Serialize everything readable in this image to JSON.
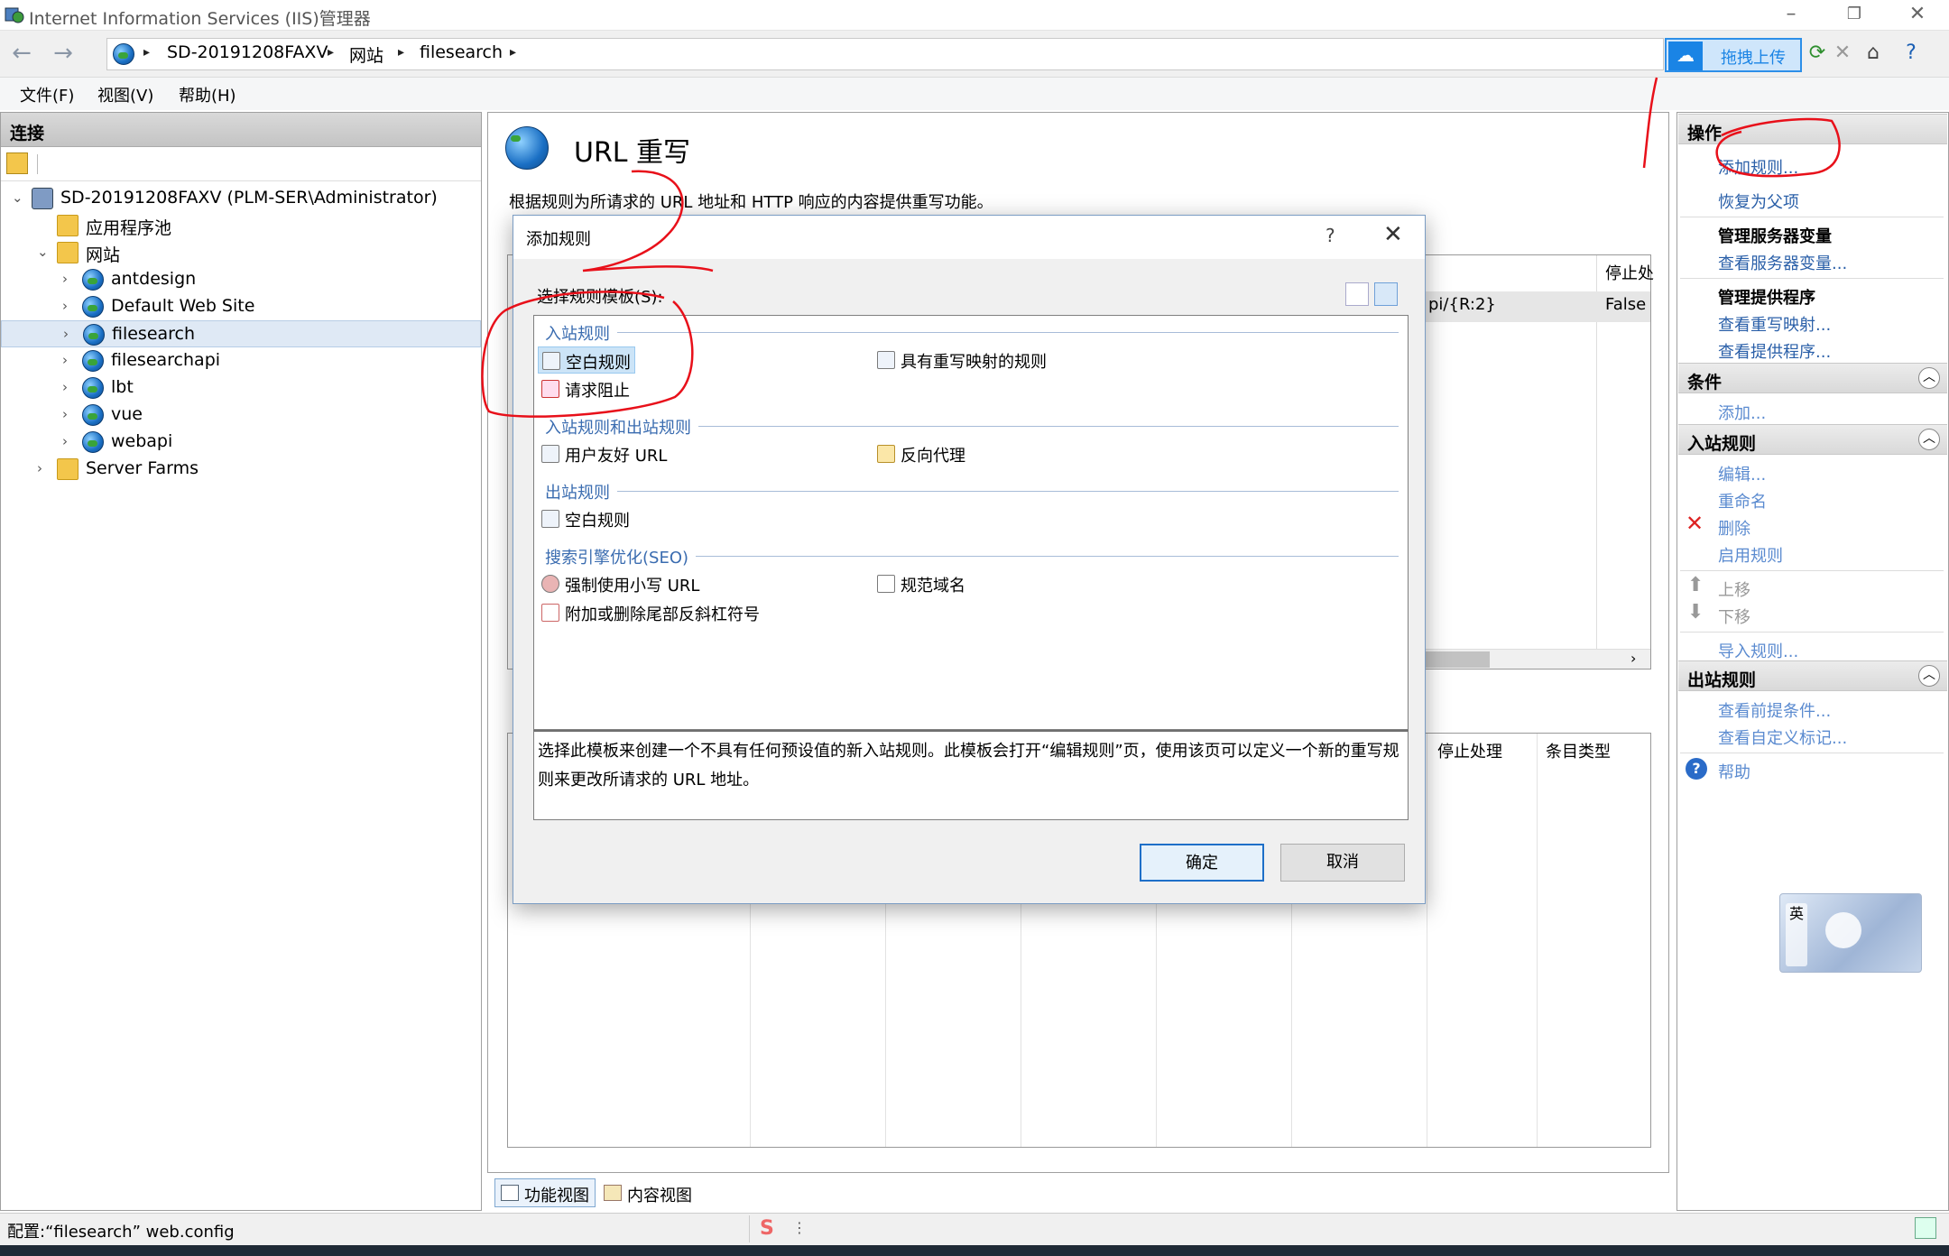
{
  "window": {
    "title": "Internet Information Services (IIS)管理器",
    "min": "–",
    "restore": "❐",
    "close": "✕"
  },
  "address": {
    "back": "←",
    "forward": "→",
    "crumbs": [
      "SD-20191208FAXV",
      "网站",
      "filesearch"
    ],
    "sep": "▸"
  },
  "upload": {
    "label": "拖拽上传"
  },
  "menu": [
    "文件(F)",
    "视图(V)",
    "帮助(H)"
  ],
  "connections": {
    "header": "连接",
    "tree": [
      {
        "label": "SD-20191208FAXV (PLM-SER\\Administrator)",
        "level": 0,
        "twisty": "⌄"
      },
      {
        "label": "应用程序池",
        "level": 1,
        "twisty": ""
      },
      {
        "label": "网站",
        "level": 1,
        "twisty": "⌄"
      },
      {
        "label": "antdesign",
        "level": 2,
        "twisty": "›"
      },
      {
        "label": "Default Web Site",
        "level": 2,
        "twisty": "›"
      },
      {
        "label": "filesearch",
        "level": 2,
        "twisty": "›"
      },
      {
        "label": "filesearchapi",
        "level": 2,
        "twisty": "›"
      },
      {
        "label": "lbt",
        "level": 2,
        "twisty": "›"
      },
      {
        "label": "vue",
        "level": 2,
        "twisty": "›"
      },
      {
        "label": "webapi",
        "level": 2,
        "twisty": "›"
      },
      {
        "label": "Server Farms",
        "level": 1,
        "twisty": "›"
      }
    ]
  },
  "main": {
    "title": "URL 重写",
    "description": "根据规则为所请求的 URL 地址和 HTTP 响应的内容提供重写功能。",
    "grid1": {
      "col_stop": "停止处",
      "cell_pattern": "pi/{R:2}",
      "cell_false": "False"
    },
    "grid2": {
      "col_stop": "停止处理",
      "col_type": "条目类型"
    },
    "tabs": [
      "功能视图",
      "内容视图"
    ]
  },
  "actions": {
    "header": "操作",
    "add_rule": "添加规则...",
    "revert": "恢复为父项",
    "manage_vars_head": "管理服务器变量",
    "view_vars": "查看服务器变量...",
    "manage_providers_head": "管理提供程序",
    "view_maps": "查看重写映射...",
    "view_providers": "查看提供程序...",
    "conditions_head": "条件",
    "add": "添加...",
    "inbound_head": "入站规则",
    "edit": "编辑...",
    "rename": "重命名",
    "delete": "删除",
    "enable": "启用规则",
    "move_up": "上移",
    "move_down": "下移",
    "import": "导入规则...",
    "outbound_head": "出站规则",
    "view_preconditions": "查看前提条件...",
    "view_tags": "查看自定义标记...",
    "help": "帮助",
    "collapse": "︿"
  },
  "ime_widget": {
    "text": "英"
  },
  "status": {
    "text": "配置:“filesearch” web.config"
  },
  "dialog": {
    "title": "添加规则",
    "help": "?",
    "close": "✕",
    "select_label": "选择规则模板(S):",
    "groups": [
      {
        "name": "入站规则",
        "items": [
          "空白规则",
          "具有重写映射的规则",
          "请求阻止"
        ]
      },
      {
        "name": "入站规则和出站规则",
        "items": [
          "用户友好 URL",
          "反向代理"
        ]
      },
      {
        "name": "出站规则",
        "items": [
          "空白规则"
        ]
      },
      {
        "name": "搜索引擎优化(SEO)",
        "items": [
          "强制使用小写 URL",
          "规范域名",
          "附加或删除尾部反斜杠符号"
        ]
      }
    ],
    "description": "选择此模板来创建一个不具有任何预设值的新入站规则。此模板会打开“编辑规则”页，使用该页可以定义一个新的重写规则来更改所请求的 URL 地址。",
    "ok": "确定",
    "cancel": "取消"
  },
  "colors": {
    "accent": "#2a5fa8",
    "annotation": "#e8101a",
    "selection": "#cce4f7"
  }
}
